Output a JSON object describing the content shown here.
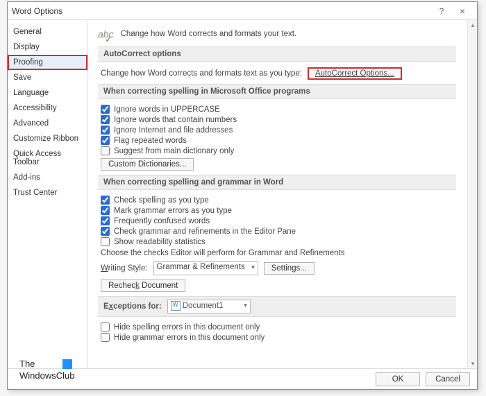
{
  "dialog": {
    "title": "Word Options"
  },
  "titlebar": {
    "help": "?",
    "close": "×"
  },
  "sidebar": {
    "items": [
      {
        "label": "General"
      },
      {
        "label": "Display"
      },
      {
        "label": "Proofing",
        "selected": true,
        "highlight": true
      },
      {
        "label": "Save"
      },
      {
        "label": "Language"
      },
      {
        "label": "Accessibility"
      },
      {
        "label": "Advanced"
      },
      {
        "label": "Customize Ribbon"
      },
      {
        "label": "Quick Access Toolbar"
      },
      {
        "label": "Add-ins"
      },
      {
        "label": "Trust Center"
      }
    ]
  },
  "intro": {
    "icon_text": "abc",
    "text": "Change how Word corrects and formats your text."
  },
  "sec_autocorrect": {
    "header": "AutoCorrect options",
    "line": "Change how Word corrects and formats text as you type:",
    "button": "AutoCorrect Options..."
  },
  "sec_office": {
    "header": "When correcting spelling in Microsoft Office programs",
    "c1": "Ignore words in UPPERCASE",
    "c2": "Ignore words that contain numbers",
    "c3": "Ignore Internet and file addresses",
    "c4": "Flag repeated words",
    "c5": "Suggest from main dictionary only",
    "btn": "Custom Dictionaries..."
  },
  "sec_word": {
    "header": "When correcting spelling and grammar in Word",
    "c1": "Check spelling as you type",
    "c2": "Mark grammar errors as you type",
    "c3": "Frequently confused words",
    "c4": "Check grammar and refinements in the Editor Pane",
    "c5": "Show readability statistics",
    "choose": "Choose the checks Editor will perform for Grammar and Refinements",
    "style_label": "Writing Style:",
    "style_value": "Grammar & Refinements",
    "settings_btn": "Settings...",
    "recheck_btn": "Recheck Document"
  },
  "sec_exc": {
    "header": "Exceptions for:",
    "doc": "Document1",
    "c1": "Hide spelling errors in this document only",
    "c2": "Hide grammar errors in this document only"
  },
  "footer": {
    "ok": "OK",
    "cancel": "Cancel"
  },
  "watermark": {
    "l1": "The",
    "l2": "WindowsClub"
  }
}
